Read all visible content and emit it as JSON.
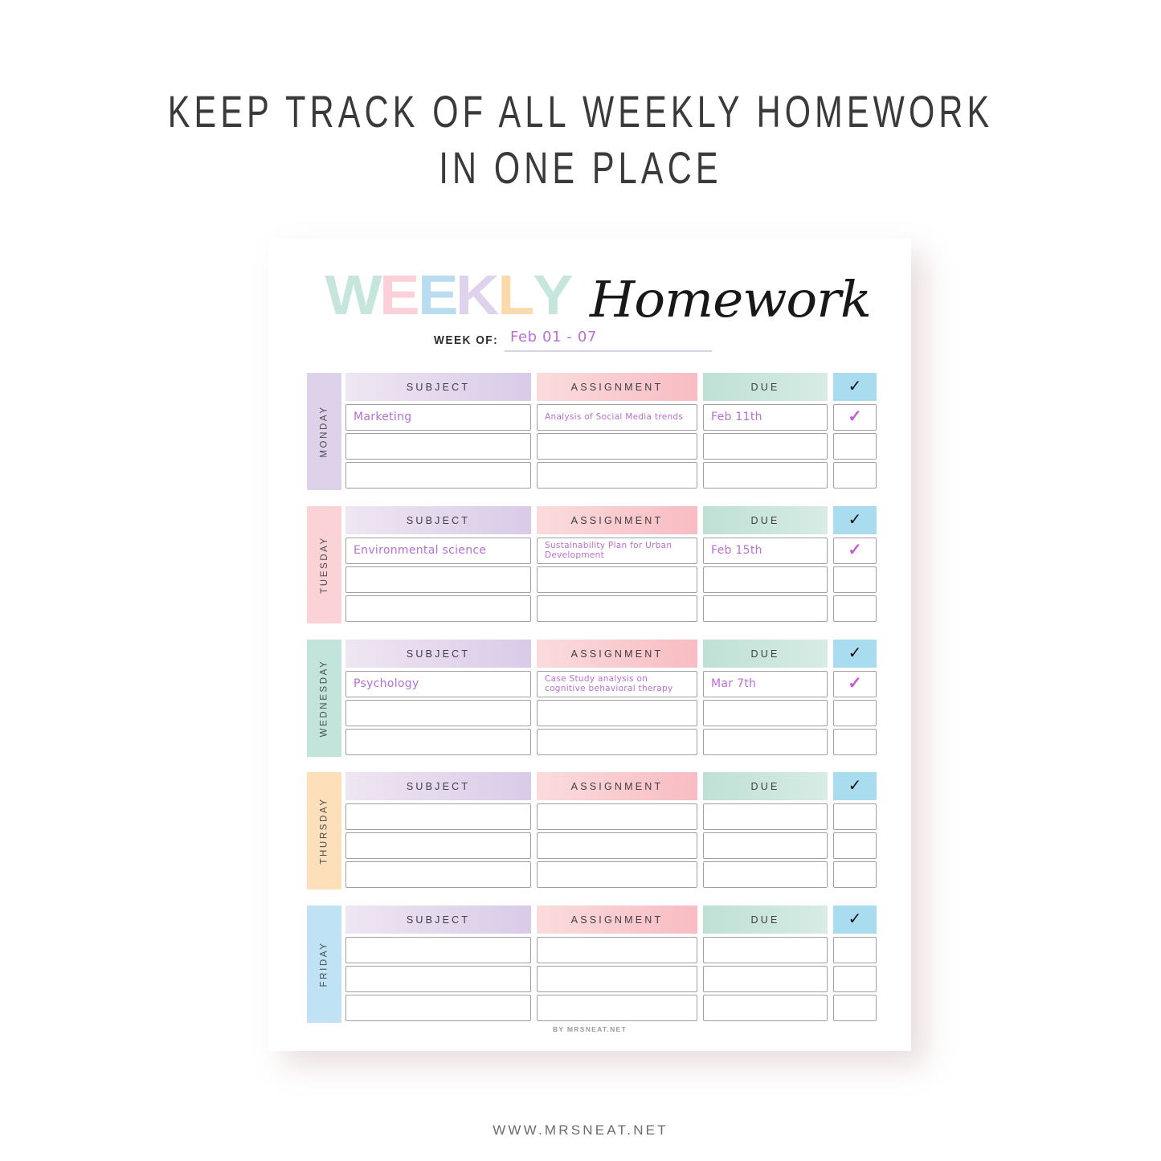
{
  "promo": {
    "headline": "KEEP TRACK OF ALL WEEKLY HOMEWORK\nIN ONE PLACE",
    "footer_url": "WWW.MRSNEAT.NET"
  },
  "planner": {
    "title_word": "WEEKLY",
    "title_script": "Homework",
    "title_letters": [
      {
        "char": "W",
        "color": "#c6e6dd"
      },
      {
        "char": "E",
        "color": "#fbd0d8"
      },
      {
        "char": "E",
        "color": "#b9dcf1"
      },
      {
        "char": "K",
        "color": "#dfd2ec"
      },
      {
        "char": "L",
        "color": "#fbd9ab"
      },
      {
        "char": "Y",
        "color": "#c6e6dd"
      }
    ],
    "week_of_label": "WEEK OF:",
    "week_of_value": "Feb 01 - 07",
    "credit": "BY MRSNEAT.NET",
    "columns": {
      "subject": "SUBJECT",
      "assignment": "ASSIGNMENT",
      "due": "DUE",
      "check": "✓"
    },
    "colors": {
      "subject_header": "#d9cbe8",
      "assignment_header": "#f8bcc2",
      "due_header": "#bfe0d6",
      "check_header": "#a9dcef",
      "handwriting": "#b86fd6",
      "tick": "#c45fd8"
    },
    "days": [
      {
        "name": "MONDAY",
        "tab_color": "#ddd2ea",
        "rows": [
          {
            "subject": "Marketing",
            "assignment": "Analysis of Social Media trends",
            "due": "Feb 11th",
            "done": true
          },
          {
            "subject": "",
            "assignment": "",
            "due": "",
            "done": false
          },
          {
            "subject": "",
            "assignment": "",
            "due": "",
            "done": false
          }
        ]
      },
      {
        "name": "TUESDAY",
        "tab_color": "#fbd2d6",
        "rows": [
          {
            "subject": "Environmental science",
            "assignment": "Sustainability Plan for Urban Development",
            "due": "Feb 15th",
            "done": true
          },
          {
            "subject": "",
            "assignment": "",
            "due": "",
            "done": false
          },
          {
            "subject": "",
            "assignment": "",
            "due": "",
            "done": false
          }
        ]
      },
      {
        "name": "WEDNESDAY",
        "tab_color": "#c3e4da",
        "rows": [
          {
            "subject": "Psychology",
            "assignment": "Case Study analysis on cognitive behavioral therapy",
            "due": "Mar 7th",
            "done": true
          },
          {
            "subject": "",
            "assignment": "",
            "due": "",
            "done": false
          },
          {
            "subject": "",
            "assignment": "",
            "due": "",
            "done": false
          }
        ]
      },
      {
        "name": "THURSDAY",
        "tab_color": "#fde0b9",
        "rows": [
          {
            "subject": "",
            "assignment": "",
            "due": "",
            "done": false
          },
          {
            "subject": "",
            "assignment": "",
            "due": "",
            "done": false
          },
          {
            "subject": "",
            "assignment": "",
            "due": "",
            "done": false
          }
        ]
      },
      {
        "name": "FRIDAY",
        "tab_color": "#bfe2f4",
        "rows": [
          {
            "subject": "",
            "assignment": "",
            "due": "",
            "done": false
          },
          {
            "subject": "",
            "assignment": "",
            "due": "",
            "done": false
          },
          {
            "subject": "",
            "assignment": "",
            "due": "",
            "done": false
          }
        ]
      }
    ]
  }
}
